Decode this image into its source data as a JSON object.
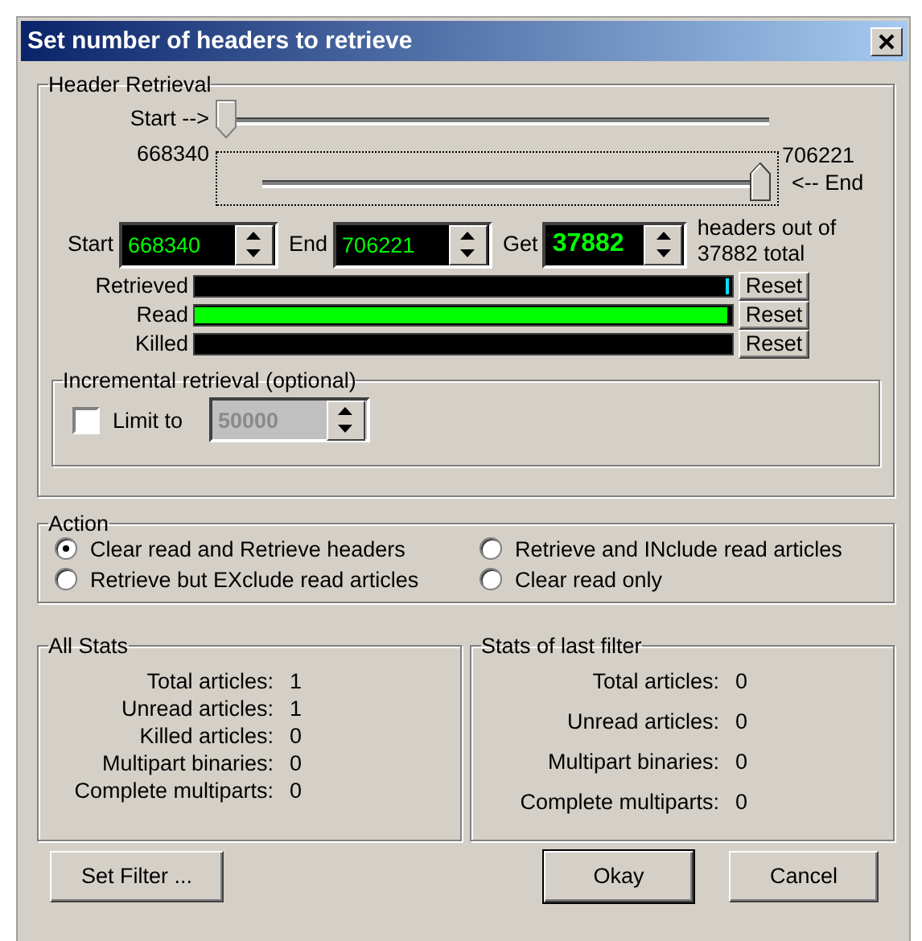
{
  "window": {
    "title": "Set number of headers to retrieve"
  },
  "header_retrieval": {
    "title": "Header Retrieval",
    "start_slider": {
      "label": "Start -->",
      "reading": "668340",
      "level": 0
    },
    "end_slider": {
      "label": "<-- End",
      "reading": "706221",
      "level": 1
    },
    "fields": [
      {
        "label": "Start",
        "value": "668340",
        "bold": false
      },
      {
        "label": "End",
        "value": "706221",
        "bold": false
      },
      {
        "label": "Get",
        "value": "37882",
        "bold": true
      }
    ],
    "summary": "headers out of 37882 total",
    "bars": [
      {
        "label": "Retrieved",
        "kind": "marker",
        "level": 1,
        "color": "#00e0ff",
        "button": "Reset"
      },
      {
        "label": "Read",
        "kind": "fill",
        "level": 0.99,
        "color": "#00ff00",
        "button": "Reset"
      },
      {
        "label": "Killed",
        "kind": "fill",
        "level": 0,
        "button": "Reset"
      }
    ],
    "incremental": {
      "title": "Incremental retrieval (optional)",
      "label": "Limit to",
      "checked": false,
      "value": "50000",
      "disabled": true
    }
  },
  "action": {
    "title": "Action",
    "options": [
      {
        "label": "Clear read and Retrieve headers",
        "selected": true
      },
      {
        "label": "Retrieve and INclude read articles",
        "selected": false
      },
      {
        "label": "Retrieve but EXclude read articles",
        "selected": false
      },
      {
        "label": "Clear read only",
        "selected": false
      }
    ]
  },
  "all_stats": {
    "title": "All Stats",
    "rows": [
      {
        "label": "Total articles:",
        "value": "1"
      },
      {
        "label": "Unread articles:",
        "value": "1"
      },
      {
        "label": "Killed articles:",
        "value": "0"
      },
      {
        "label": "Multipart binaries:",
        "value": "0"
      },
      {
        "label": "Complete multiparts:",
        "value": "0"
      }
    ]
  },
  "last_filter_stats": {
    "title": "Stats of last filter",
    "rows": [
      {
        "label": "Total articles:",
        "value": "0"
      },
      {
        "label": "Unread articles:",
        "value": "0"
      },
      {
        "label": "Multipart binaries:",
        "value": "0"
      },
      {
        "label": "Complete multiparts:",
        "value": "0"
      }
    ]
  },
  "buttons": [
    {
      "label": "Set Filter ...",
      "default": false
    },
    {
      "label": "Okay",
      "default": true
    },
    {
      "label": "Cancel",
      "default": false
    }
  ]
}
